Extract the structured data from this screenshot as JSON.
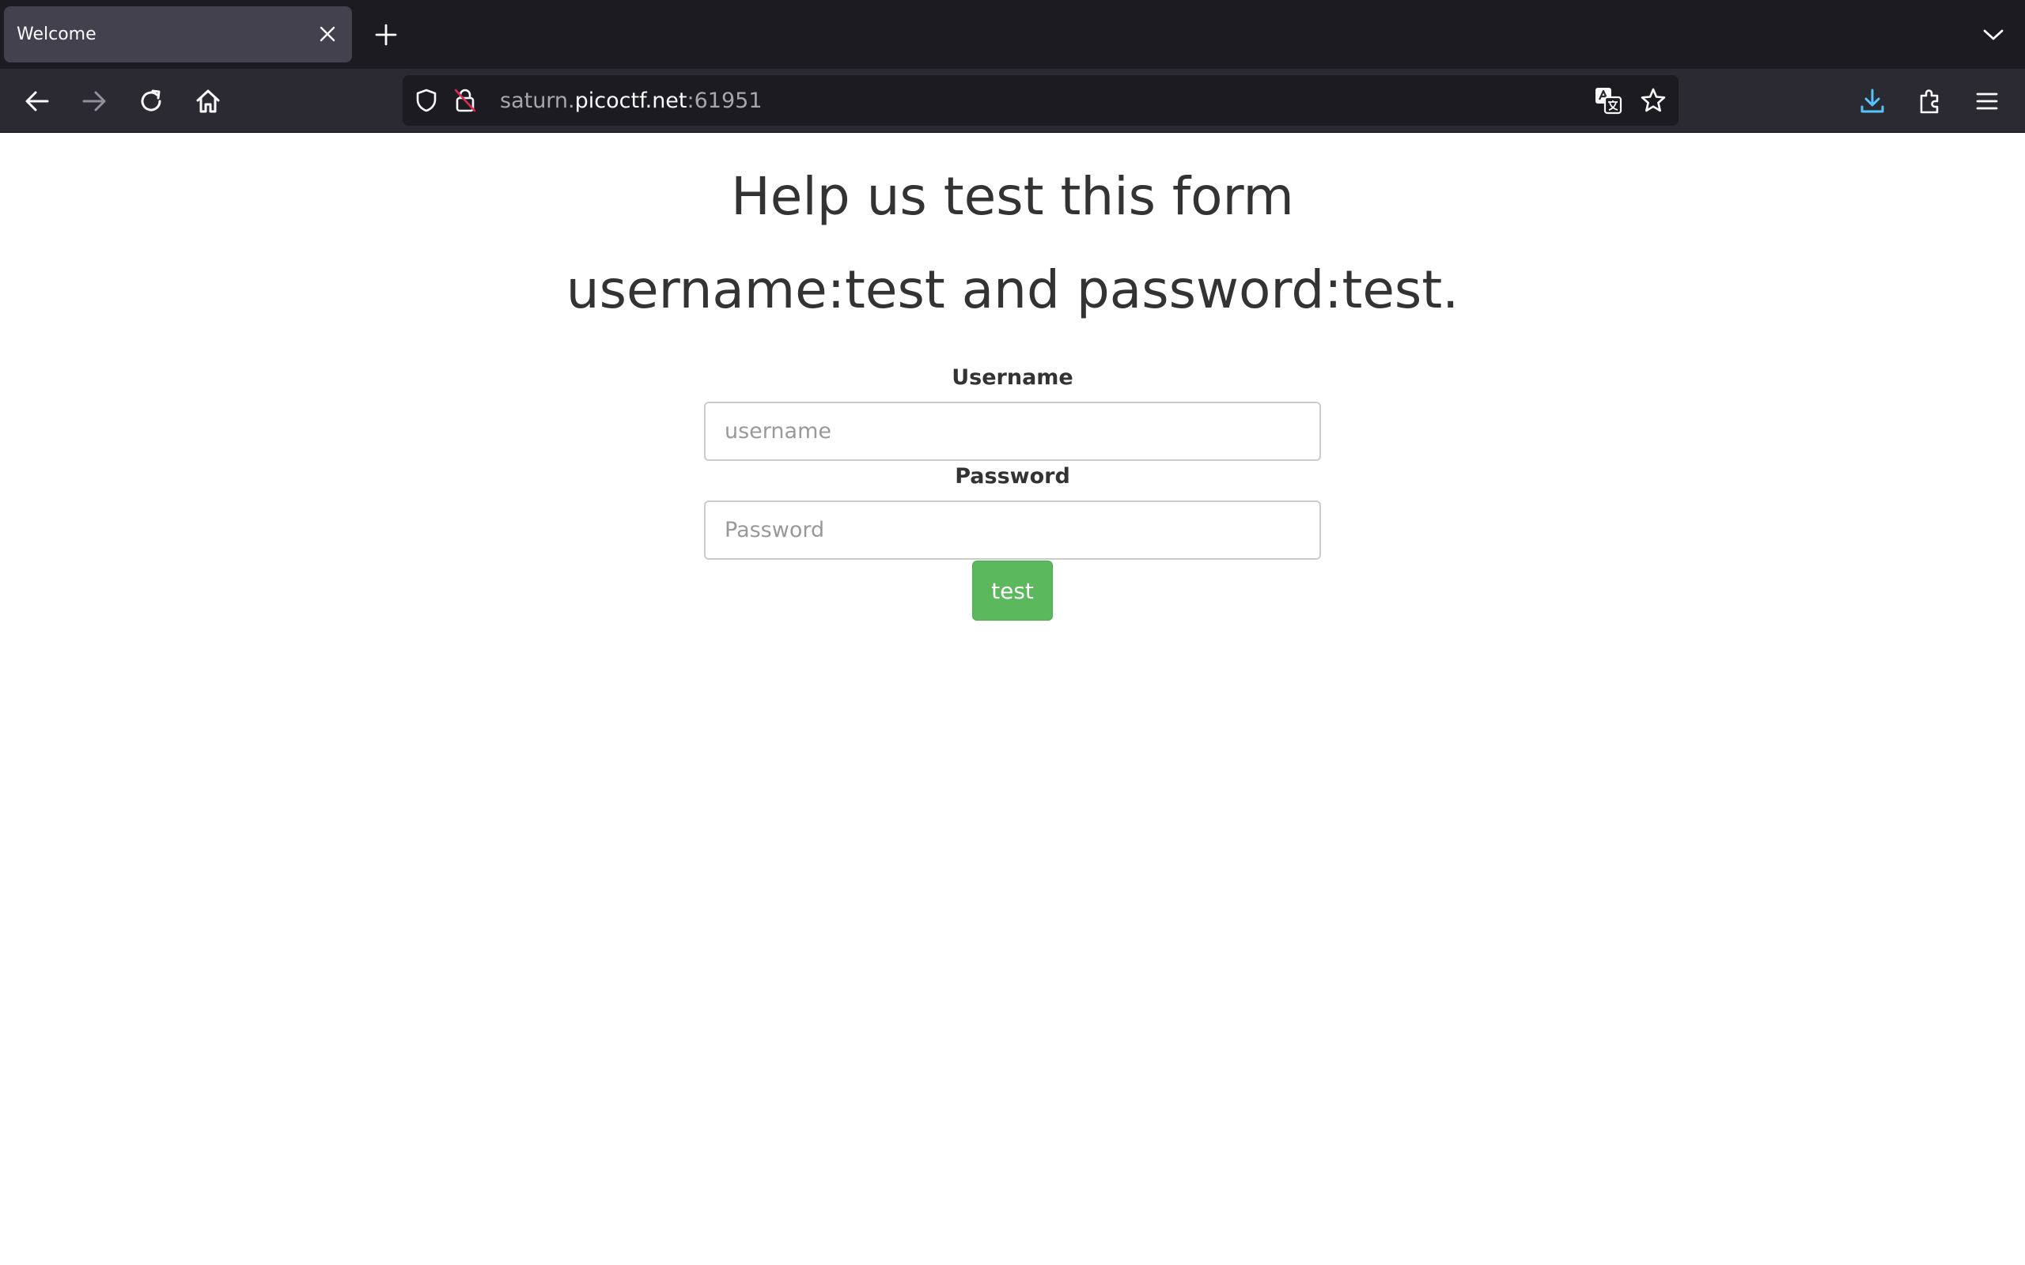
{
  "browser": {
    "tab": {
      "title": "Welcome"
    },
    "url": {
      "prefix": "saturn.",
      "host": "picoctf.net",
      "suffix": ":61951"
    },
    "icons": {
      "tab_close": "close-icon",
      "new_tab": "plus-icon",
      "tab_list": "chevron-down-icon",
      "back": "arrow-left-icon",
      "forward": "arrow-right-icon",
      "reload": "reload-icon",
      "home": "home-icon",
      "tracking_protection": "shield-icon",
      "connection": "insecure-lock-icon",
      "translate": "translate-icon",
      "bookmark": "star-icon",
      "downloads": "download-icon",
      "extensions": "puzzle-icon",
      "menu": "hamburger-menu-icon"
    },
    "colors": {
      "download_accent": "#54c5f8"
    }
  },
  "page": {
    "heading_line1": "Help us test this form",
    "heading_line2": "username:test and password:test.",
    "username_label": "Username",
    "username_placeholder": "username",
    "username_value": "",
    "password_label": "Password",
    "password_placeholder": "Password",
    "password_value": "",
    "submit_label": "test",
    "colors": {
      "text": "#333333",
      "button": "#5cb85c"
    }
  }
}
